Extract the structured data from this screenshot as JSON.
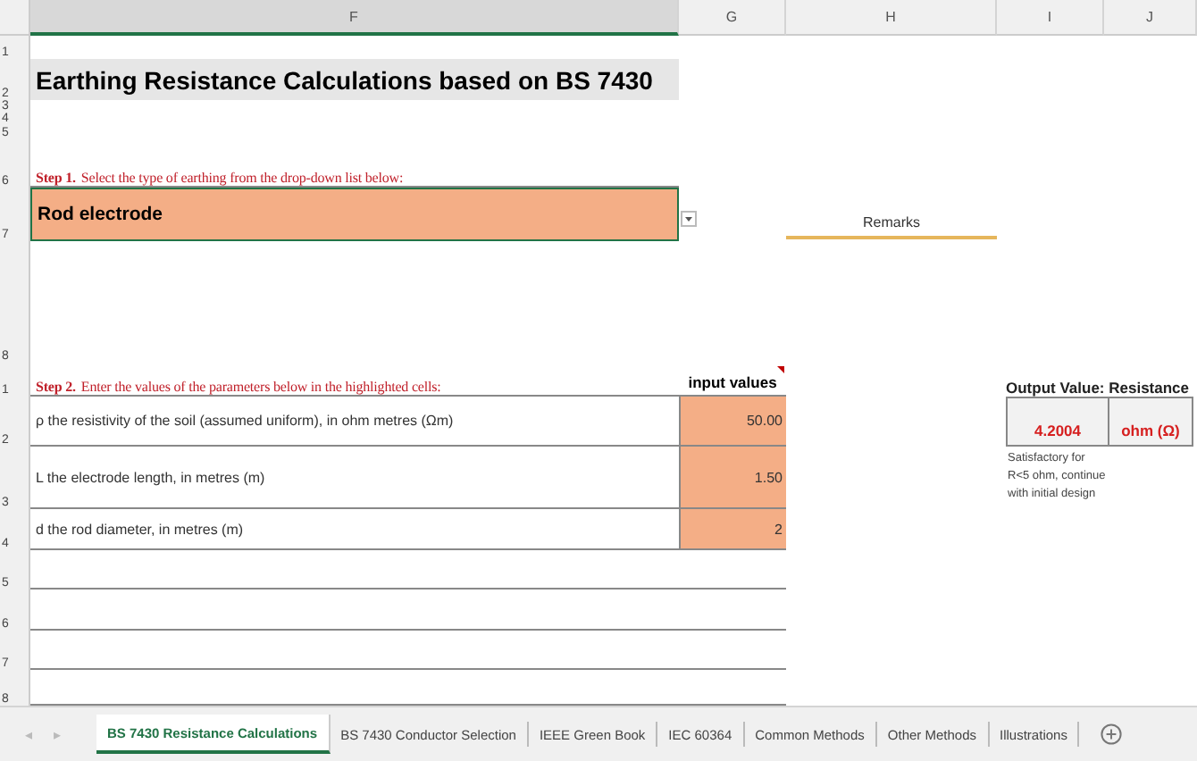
{
  "columns": [
    "F",
    "G",
    "H",
    "I",
    "J"
  ],
  "row_numbers": [
    "1",
    "2",
    "3",
    "4",
    "5",
    "6",
    "7",
    "8",
    "1",
    "2",
    "3",
    "4",
    "5",
    "6",
    "7",
    "8"
  ],
  "title": "Earthing Resistance Calculations based on BS 7430",
  "step1": "**Step 1.** Select the type of earthing from the drop-down list below:",
  "earthing_type": {
    "value": "Rod electrode"
  },
  "remarks": "Remarks",
  "step2": "**Step 2.** Enter the values of the parameters below in the highlighted cells:",
  "input_header": "input values",
  "parameters": [
    {
      "label": "ρ  the resistivity of the soil (assumed uniform), in ohm metres (Ωm)",
      "value": "50.00"
    },
    {
      "label": "L  the electrode length, in metres (m)",
      "value": "1.50"
    },
    {
      "label": "d   the rod diameter, in metres (m)",
      "value": "2"
    }
  ],
  "output": {
    "title": "Output Value: Resistance",
    "value": "4.2004",
    "unit": "ohm (Ω)",
    "note": [
      "Satisfactory for",
      "R<5 ohm, continue",
      "with initial design"
    ]
  },
  "tab_nav": [
    "◂",
    "▸"
  ],
  "sheet_tabs": [
    {
      "label": "BS 7430 Resistance Calculations",
      "selected": true
    },
    {
      "label": "BS 7430 Conductor Selection",
      "selected": false
    },
    {
      "label": "IEEE Green Book",
      "selected": false
    },
    {
      "label": "IEC 60364",
      "selected": false
    },
    {
      "label": "Common Methods",
      "selected": false
    },
    {
      "label": "Other Methods",
      "selected": false
    },
    {
      "label": "Illustrations",
      "selected": false
    }
  ]
}
